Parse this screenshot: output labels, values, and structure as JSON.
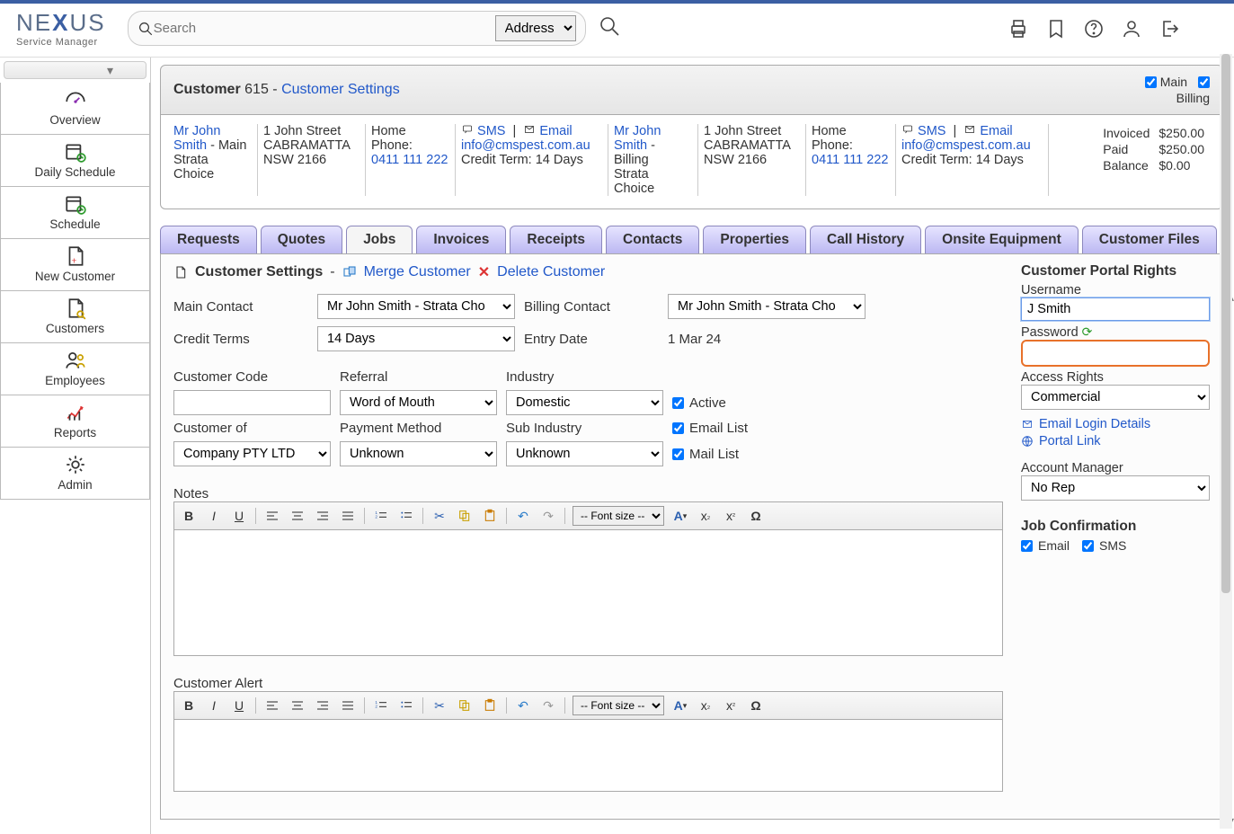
{
  "logo": {
    "line1_a": "N",
    "line1_b": "E",
    "line1_c": "X",
    "line1_d": "US",
    "line2": "Service Manager"
  },
  "search": {
    "placeholder": "Search",
    "type_selected": "Address"
  },
  "sidebar": {
    "items": [
      "Overview",
      "Daily Schedule",
      "Schedule",
      "New Customer",
      "Customers",
      "Employees",
      "Reports",
      "Admin"
    ]
  },
  "page_header": {
    "title_prefix": "Customer",
    "customer_number": "615",
    "separator": "-",
    "link": "Customer Settings",
    "chk_main": "Main",
    "chk_billing": "Billing"
  },
  "details": {
    "main": {
      "name": "Mr John Smith",
      "role": "- Main",
      "team": "Strata Choice",
      "addr1": "1 John Street",
      "addr2": "CABRAMATTA",
      "addr3": "NSW 2166",
      "phone_label": "Home Phone:",
      "phone": "0411 111 222",
      "credit_term": "Credit Term: 14 Days",
      "sms": "SMS",
      "email_lbl": "Email",
      "email": "info@cmspest.com.au"
    },
    "billing": {
      "name": "Mr John Smith",
      "role": "- Billing",
      "team": "Strata Choice",
      "addr1": "1 John Street",
      "addr2": "CABRAMATTA",
      "addr3": "NSW 2166",
      "phone_label": "Home Phone:",
      "phone": "0411 111 222",
      "credit_term": "Credit Term: 14 Days",
      "sms": "SMS",
      "email_lbl": "Email",
      "email": "info@cmspest.com.au"
    },
    "finance": {
      "invoiced_l": "Invoiced",
      "invoiced_v": "$250.00",
      "paid_l": "Paid",
      "paid_v": "$250.00",
      "balance_l": "Balance",
      "balance_v": "$0.00"
    }
  },
  "tabs": [
    "Requests",
    "Quotes",
    "Jobs",
    "Invoices",
    "Receipts",
    "Contacts",
    "Properties",
    "Call History",
    "Onsite Equipment",
    "Customer Files"
  ],
  "active_tab": "Jobs",
  "settings_bar": {
    "title": "Customer Settings",
    "merge": "Merge Customer",
    "delete": "Delete Customer"
  },
  "form": {
    "main_contact_l": "Main Contact",
    "main_contact_v": "Mr John Smith - Strata Cho",
    "billing_contact_l": "Billing Contact",
    "billing_contact_v": "Mr John Smith - Strata Cho",
    "credit_terms_l": "Credit Terms",
    "credit_terms_v": "14 Days",
    "entry_date_l": "Entry Date",
    "entry_date_v": "1 Mar 24",
    "customer_code_l": "Customer Code",
    "customer_code_v": "",
    "referral_l": "Referral",
    "referral_v": "Word of Mouth",
    "industry_l": "Industry",
    "industry_v": "Domestic",
    "customer_of_l": "Customer of",
    "customer_of_v": "Company PTY LTD",
    "payment_method_l": "Payment Method",
    "payment_method_v": "Unknown",
    "sub_industry_l": "Sub Industry",
    "sub_industry_v": "Unknown",
    "chk_active": "Active",
    "chk_email_list": "Email List",
    "chk_mail_list": "Mail List",
    "notes_l": "Notes",
    "alert_l": "Customer Alert",
    "font_size_lbl": "-- Font size --"
  },
  "portal": {
    "heading": "Customer Portal Rights",
    "username_l": "Username",
    "username_v": "J Smith",
    "password_l": "Password",
    "password_v": "",
    "access_l": "Access Rights",
    "access_v": "Commercial",
    "email_login": "Email Login Details",
    "portal_link": "Portal Link",
    "acct_mgr_l": "Account Manager",
    "acct_mgr_v": "No Rep",
    "job_conf_l": "Job Confirmation",
    "conf_email": "Email",
    "conf_sms": "SMS"
  }
}
